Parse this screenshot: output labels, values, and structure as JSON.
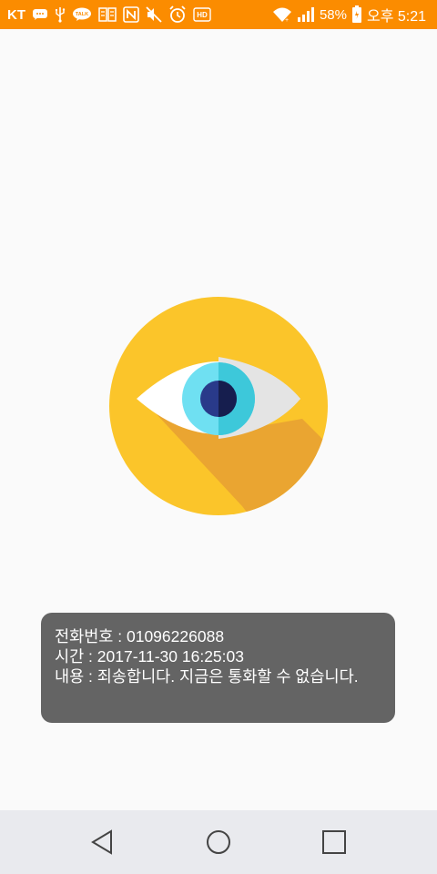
{
  "status_bar": {
    "carrier": "KT",
    "battery_percent": "58%",
    "time": "오후 5:21",
    "background_color": "#fb8c00",
    "icons": [
      "chat-bubble-icon",
      "usb-icon",
      "kakaotalk-icon",
      "cast-icon",
      "nfc-icon",
      "mute-icon",
      "alarm-icon",
      "hd-voice-icon",
      "wifi-icon",
      "signal-icon",
      "battery-icon"
    ]
  },
  "app_logo": {
    "icon": "eye-icon",
    "circle_color": "#fbc52a",
    "shadow_color": "#eaa531"
  },
  "toast": {
    "phone_line": "전화번호 : 01096226088",
    "time_line": "시간 : 2017-11-30 16:25:03",
    "content_line": "내용 : 죄송합니다. 지금은 통화할 수 없습니다."
  },
  "nav_bar": {
    "back_icon": "back-icon",
    "home_icon": "home-icon",
    "recents_icon": "recents-icon"
  }
}
